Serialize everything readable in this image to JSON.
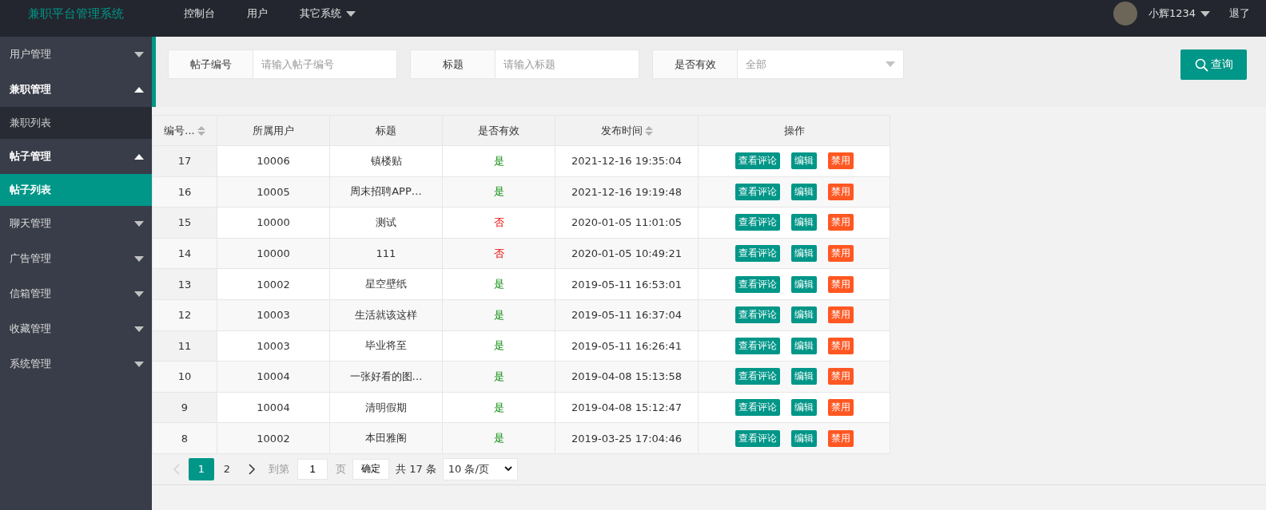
{
  "header": {
    "logo": "兼职平台管理系统",
    "nav": [
      {
        "label": "控制台",
        "dropdown": false
      },
      {
        "label": "用户",
        "dropdown": false
      },
      {
        "label": "其它系统",
        "dropdown": true
      }
    ],
    "user": "小辉1234",
    "logout": "退了"
  },
  "sidebar": {
    "groups": [
      {
        "label": "用户管理",
        "expanded": false
      },
      {
        "label": "兼职管理",
        "expanded": true,
        "children": [
          {
            "label": "兼职列表",
            "selected": false
          }
        ]
      },
      {
        "label": "帖子管理",
        "expanded": true,
        "children": [
          {
            "label": "帖子列表",
            "selected": true
          }
        ]
      },
      {
        "label": "聊天管理",
        "expanded": false
      },
      {
        "label": "广告管理",
        "expanded": false
      },
      {
        "label": "信箱管理",
        "expanded": false
      },
      {
        "label": "收藏管理",
        "expanded": false
      },
      {
        "label": "系统管理",
        "expanded": false
      }
    ]
  },
  "search": {
    "fields": [
      {
        "kind": "input",
        "label": "帖子编号",
        "placeholder": "请输入帖子编号"
      },
      {
        "kind": "input",
        "label": "标题",
        "placeholder": "请输入标题"
      },
      {
        "kind": "select",
        "label": "是否有效",
        "value": "全部"
      }
    ],
    "button": "查询"
  },
  "table": {
    "columns": [
      {
        "label": "编号...",
        "sortable": true
      },
      {
        "label": "所属用户",
        "sortable": false
      },
      {
        "label": "标题",
        "sortable": false
      },
      {
        "label": "是否有效",
        "sortable": false
      },
      {
        "label": "发布时间",
        "sortable": true
      },
      {
        "label": "操作",
        "sortable": false
      }
    ],
    "rows": [
      {
        "id": "17",
        "user": "10006",
        "title": "镇楼贴",
        "valid": {
          "text": "是",
          "on": true
        },
        "time": "2021-12-16 19:35:04",
        "actions": [
          {
            "label": "查看评论",
            "kind": "primary"
          },
          {
            "label": "编辑",
            "kind": "primary"
          },
          {
            "label": "禁用",
            "kind": "danger"
          }
        ]
      },
      {
        "id": "16",
        "user": "10005",
        "title": "周末招聘APP…",
        "valid": {
          "text": "是",
          "on": true
        },
        "time": "2021-12-16 19:19:48",
        "actions": [
          {
            "label": "查看评论",
            "kind": "primary"
          },
          {
            "label": "编辑",
            "kind": "primary"
          },
          {
            "label": "禁用",
            "kind": "danger"
          }
        ]
      },
      {
        "id": "15",
        "user": "10000",
        "title": "测试",
        "valid": {
          "text": "否",
          "on": false
        },
        "time": "2020-01-05 11:01:05",
        "actions": [
          {
            "label": "查看评论",
            "kind": "primary"
          },
          {
            "label": "编辑",
            "kind": "primary"
          },
          {
            "label": "禁用",
            "kind": "danger"
          }
        ]
      },
      {
        "id": "14",
        "user": "10000",
        "title": "111",
        "valid": {
          "text": "否",
          "on": false
        },
        "time": "2020-01-05 10:49:21",
        "actions": [
          {
            "label": "查看评论",
            "kind": "primary"
          },
          {
            "label": "编辑",
            "kind": "primary"
          },
          {
            "label": "禁用",
            "kind": "danger"
          }
        ]
      },
      {
        "id": "13",
        "user": "10002",
        "title": "星空壁纸",
        "valid": {
          "text": "是",
          "on": true
        },
        "time": "2019-05-11 16:53:01",
        "actions": [
          {
            "label": "查看评论",
            "kind": "primary"
          },
          {
            "label": "编辑",
            "kind": "primary"
          },
          {
            "label": "禁用",
            "kind": "danger"
          }
        ]
      },
      {
        "id": "12",
        "user": "10003",
        "title": "生活就该这样",
        "valid": {
          "text": "是",
          "on": true
        },
        "time": "2019-05-11 16:37:04",
        "actions": [
          {
            "label": "查看评论",
            "kind": "primary"
          },
          {
            "label": "编辑",
            "kind": "primary"
          },
          {
            "label": "禁用",
            "kind": "danger"
          }
        ]
      },
      {
        "id": "11",
        "user": "10003",
        "title": "毕业将至",
        "valid": {
          "text": "是",
          "on": true
        },
        "time": "2019-05-11 16:26:41",
        "actions": [
          {
            "label": "查看评论",
            "kind": "primary"
          },
          {
            "label": "编辑",
            "kind": "primary"
          },
          {
            "label": "禁用",
            "kind": "danger"
          }
        ]
      },
      {
        "id": "10",
        "user": "10004",
        "title": "一张好看的图…",
        "valid": {
          "text": "是",
          "on": true
        },
        "time": "2019-04-08 15:13:58",
        "actions": [
          {
            "label": "查看评论",
            "kind": "primary"
          },
          {
            "label": "编辑",
            "kind": "primary"
          },
          {
            "label": "禁用",
            "kind": "danger"
          }
        ]
      },
      {
        "id": "9",
        "user": "10004",
        "title": "清明假期",
        "valid": {
          "text": "是",
          "on": true
        },
        "time": "2019-04-08 15:12:47",
        "actions": [
          {
            "label": "查看评论",
            "kind": "primary"
          },
          {
            "label": "编辑",
            "kind": "primary"
          },
          {
            "label": "禁用",
            "kind": "danger"
          }
        ]
      },
      {
        "id": "8",
        "user": "10002",
        "title": "本田雅阁",
        "valid": {
          "text": "是",
          "on": true
        },
        "time": "2019-03-25 17:04:46",
        "actions": [
          {
            "label": "查看评论",
            "kind": "primary"
          },
          {
            "label": "编辑",
            "kind": "primary"
          },
          {
            "label": "禁用",
            "kind": "danger"
          }
        ]
      }
    ]
  },
  "pagination": {
    "prev_disabled": true,
    "pages": [
      {
        "label": "1",
        "selected": true
      },
      {
        "label": "2",
        "selected": false
      }
    ],
    "goto": "到第",
    "goto_value": "1",
    "page_unit": "页",
    "confirm": "确定",
    "total": "共 17 条",
    "page_size": "10 条/页"
  }
}
